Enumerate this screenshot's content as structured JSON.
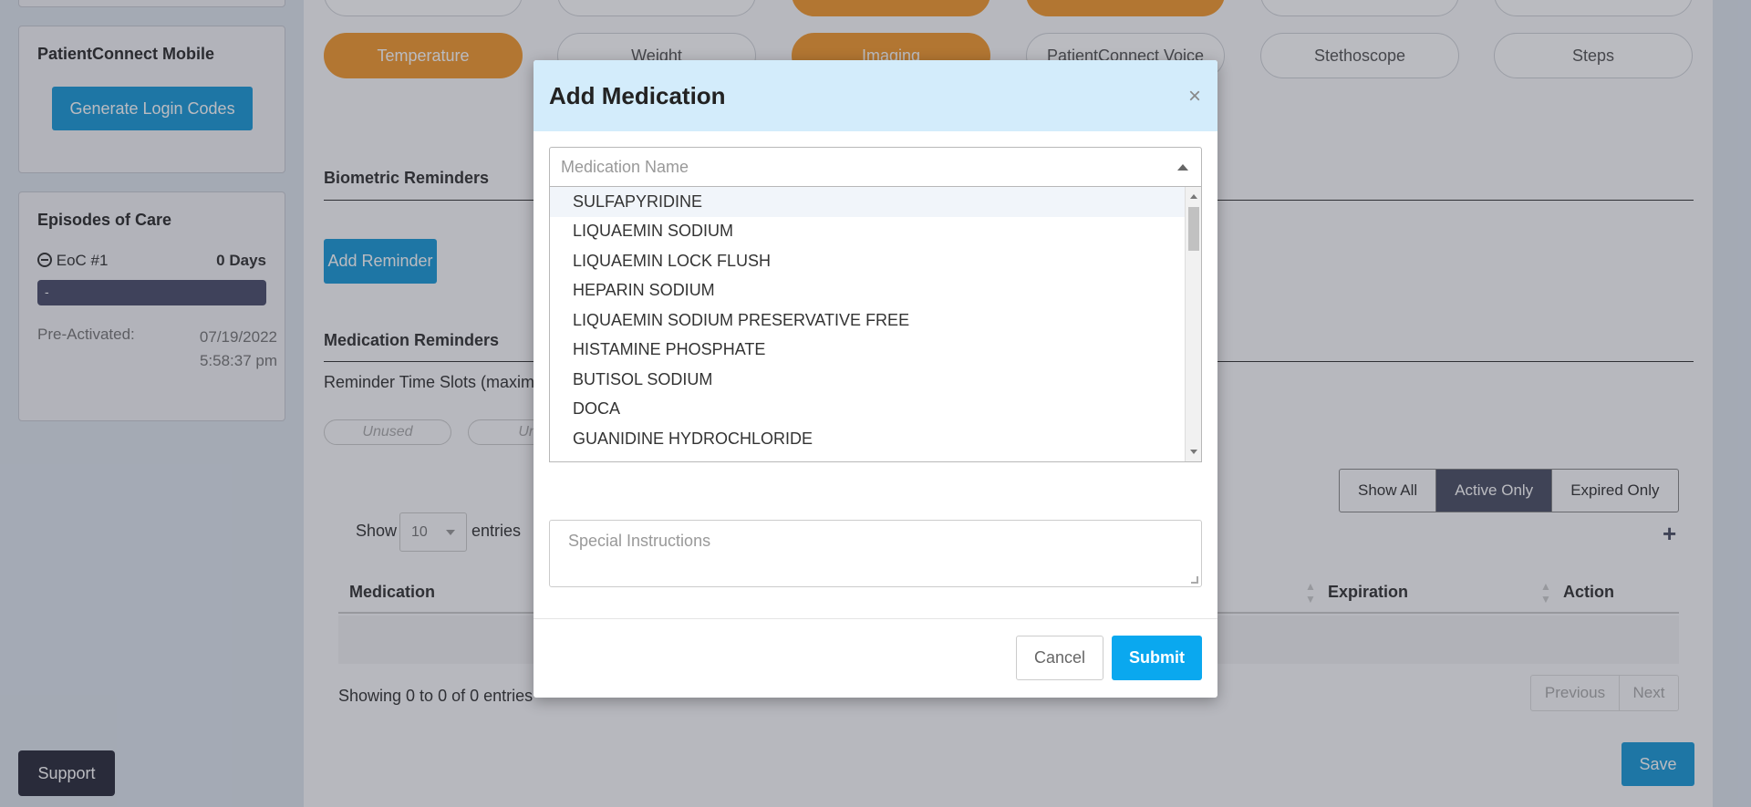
{
  "sidebar": {
    "mobile": {
      "title": "PatientConnect Mobile",
      "generate_button": "Generate Login Codes"
    },
    "episodes": {
      "title": "Episodes of Care",
      "eoc_label": "EoC #1",
      "eoc_days": "0 Days",
      "bar_text": "-",
      "pre_activated_label": "Pre-Activated:",
      "pre_activated_date": "07/19/2022",
      "pre_activated_time": "5:58:37 pm"
    },
    "support_button": "Support"
  },
  "devices": {
    "row2": [
      "Temperature",
      "Weight",
      "Imaging",
      "PatientConnect Voice",
      "Stethoscope",
      "Steps"
    ],
    "row2_active": [
      true,
      false,
      true,
      false,
      false,
      false
    ],
    "row1_active": [
      false,
      false,
      true,
      true,
      false,
      false
    ]
  },
  "biometric": {
    "title": "Biometric Reminders",
    "add_button": "Add Reminder"
  },
  "medication": {
    "title": "Medication Reminders",
    "time_slots_label": "Reminder Time Slots (maximu",
    "slot1": "Unused",
    "slot2": "Unu",
    "filters": [
      "Show All",
      "Active Only",
      "Expired Only"
    ],
    "active_filter": "Active Only",
    "show_label": "Show",
    "entries_value": "10",
    "entries_label": "entries",
    "add_icon": "plus-icon",
    "columns": [
      "Medication",
      "Expiration",
      "Action"
    ],
    "showing_text": "Showing 0 to 0 of 0 entries",
    "prev_label": "Previous",
    "next_label": "Next",
    "save_button": "Save"
  },
  "modal": {
    "title": "Add Medication",
    "close_icon": "close-icon",
    "medication_placeholder": "Medication Name",
    "options": [
      "SULFAPYRIDINE",
      "LIQUAEMIN SODIUM",
      "LIQUAEMIN LOCK FLUSH",
      "HEPARIN SODIUM",
      "LIQUAEMIN SODIUM PRESERVATIVE FREE",
      "HISTAMINE PHOSPHATE",
      "BUTISOL SODIUM",
      "DOCA",
      "GUANIDINE HYDROCHLORIDE"
    ],
    "instructions_placeholder": "Special Instructions",
    "cancel_button": "Cancel",
    "submit_button": "Submit"
  },
  "colors": {
    "accent_orange": "#f39a2e",
    "accent_blue": "#1a9ad8",
    "submit_blue": "#0aa8ef",
    "modal_header": "#d3ecfb"
  }
}
